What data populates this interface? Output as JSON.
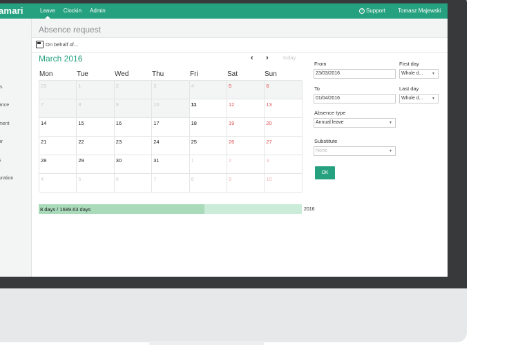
{
  "brand": "amari",
  "nav": {
    "items": [
      "Leave",
      "Clockin",
      "Admin"
    ],
    "support": "Support",
    "user": "Tomasz Majewski"
  },
  "sidebar": {
    "items": [
      "ts",
      "ance",
      "ment",
      "ar",
      "s",
      "uration"
    ]
  },
  "page": {
    "title": "Absence request",
    "on_behalf": "On behalf of..."
  },
  "calendar": {
    "month": "March 2016",
    "prev": "‹",
    "next": "›",
    "today": "today",
    "days": [
      "Mon",
      "Tue",
      "Wed",
      "Thu",
      "Fri",
      "Sat",
      "Sun"
    ],
    "weeks": [
      [
        "29",
        "1",
        "2",
        "3",
        "4",
        "5",
        "6"
      ],
      [
        "7",
        "8",
        "9",
        "10",
        "11",
        "12",
        "13"
      ],
      [
        "14",
        "15",
        "16",
        "17",
        "18",
        "19",
        "20"
      ],
      [
        "21",
        "22",
        "23",
        "24",
        "25",
        "26",
        "27"
      ],
      [
        "28",
        "29",
        "30",
        "31",
        "1",
        "2",
        "3"
      ],
      [
        "4",
        "5",
        "6",
        "7",
        "8",
        "9",
        "10"
      ]
    ]
  },
  "progress": {
    "label": "8 days / 1689.63 days",
    "fraction": 0.63,
    "year": "2016"
  },
  "form": {
    "from_label": "From",
    "from_value": "23/03/2016",
    "first_day_label": "First day",
    "first_day_value": "Whole d...",
    "to_label": "To",
    "to_value": "01/04/2016",
    "last_day_label": "Last day",
    "last_day_value": "Whole d...",
    "absence_type_label": "Absence type",
    "absence_type_value": "Annual leave",
    "substitute_label": "Substitute",
    "substitute_placeholder": "None",
    "ok": "OK"
  },
  "colors": {
    "accent": "#26a17f",
    "weekend": "#e05252",
    "progress_fill": "#a9dbbb",
    "progress_track": "#cbecd9"
  }
}
